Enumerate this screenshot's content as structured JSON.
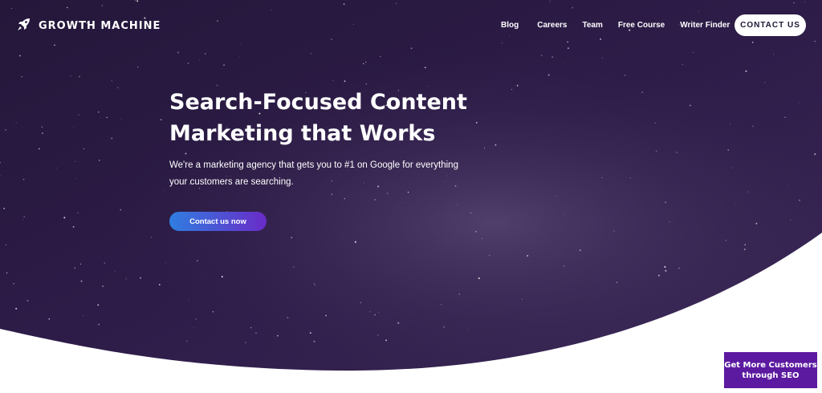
{
  "brand": {
    "name": "GROWTH MACHINE",
    "logo_icon": "rocket-icon"
  },
  "nav": {
    "links": [
      "Blog",
      "Careers",
      "Team",
      "Free Course",
      "Writer Finder"
    ],
    "contact_label": "CONTACT US"
  },
  "hero": {
    "headline_line1": "Search-Focused Content",
    "headline_line2": "Marketing that Works",
    "subtext_line1": "We're a marketing agency that gets you to #1 on Google for everything",
    "subtext_line2": "your customers are searching.",
    "cta_label": "Contact us now"
  },
  "floating_cta": {
    "line1": "Get More Customers",
    "line2": "through SEO"
  },
  "colors": {
    "hero_bg": "#2b1a45",
    "cta_gradient_start": "#2f7ee0",
    "cta_gradient_end": "#6a2bc8",
    "floating_cta_bg": "#5b1aa0"
  }
}
